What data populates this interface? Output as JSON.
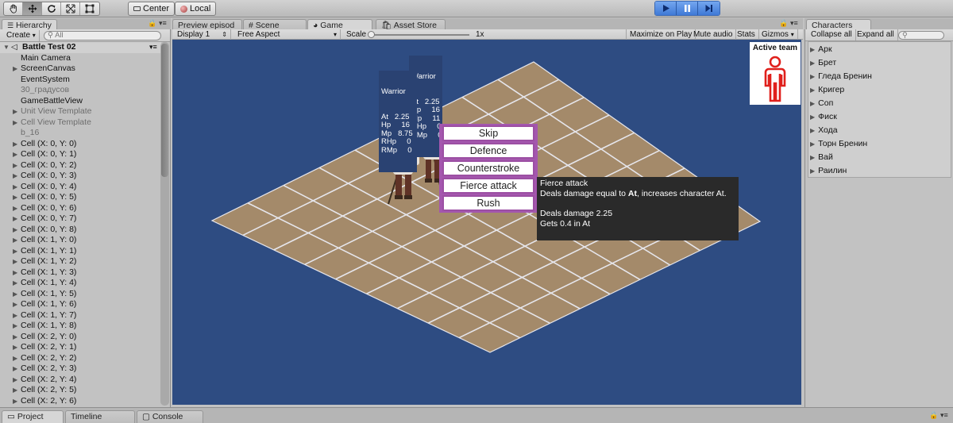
{
  "toolbar": {
    "pivot_label": "Center",
    "space_label": "Local"
  },
  "hierarchy": {
    "tab_label": "Hierarchy",
    "create_label": "Create",
    "search_placeholder": "All",
    "root_label": "Battle Test 02",
    "items": [
      {
        "label": "Main Camera",
        "expand": false,
        "inactive": false
      },
      {
        "label": "ScreenCanvas",
        "expand": true,
        "inactive": false
      },
      {
        "label": "EventSystem",
        "expand": false,
        "inactive": false
      },
      {
        "label": "30_градусов",
        "expand": false,
        "inactive": true
      },
      {
        "label": "GameBattleView",
        "expand": false,
        "inactive": false
      },
      {
        "label": "Unit View Template",
        "expand": true,
        "inactive": true
      },
      {
        "label": "Cell View Template",
        "expand": true,
        "inactive": true
      },
      {
        "label": "b_16",
        "expand": false,
        "inactive": true
      },
      {
        "label": "Cell (X: 0, Y: 0)",
        "expand": true,
        "inactive": false
      },
      {
        "label": "Cell (X: 0, Y: 1)",
        "expand": true,
        "inactive": false
      },
      {
        "label": "Cell (X: 0, Y: 2)",
        "expand": true,
        "inactive": false
      },
      {
        "label": "Cell (X: 0, Y: 3)",
        "expand": true,
        "inactive": false
      },
      {
        "label": "Cell (X: 0, Y: 4)",
        "expand": true,
        "inactive": false
      },
      {
        "label": "Cell (X: 0, Y: 5)",
        "expand": true,
        "inactive": false
      },
      {
        "label": "Cell (X: 0, Y: 6)",
        "expand": true,
        "inactive": false
      },
      {
        "label": "Cell (X: 0, Y: 7)",
        "expand": true,
        "inactive": false
      },
      {
        "label": "Cell (X: 0, Y: 8)",
        "expand": true,
        "inactive": false
      },
      {
        "label": "Cell (X: 1, Y: 0)",
        "expand": true,
        "inactive": false
      },
      {
        "label": "Cell (X: 1, Y: 1)",
        "expand": true,
        "inactive": false
      },
      {
        "label": "Cell (X: 1, Y: 2)",
        "expand": true,
        "inactive": false
      },
      {
        "label": "Cell (X: 1, Y: 3)",
        "expand": true,
        "inactive": false
      },
      {
        "label": "Cell (X: 1, Y: 4)",
        "expand": true,
        "inactive": false
      },
      {
        "label": "Cell (X: 1, Y: 5)",
        "expand": true,
        "inactive": false
      },
      {
        "label": "Cell (X: 1, Y: 6)",
        "expand": true,
        "inactive": false
      },
      {
        "label": "Cell (X: 1, Y: 7)",
        "expand": true,
        "inactive": false
      },
      {
        "label": "Cell (X: 1, Y: 8)",
        "expand": true,
        "inactive": false
      },
      {
        "label": "Cell (X: 2, Y: 0)",
        "expand": true,
        "inactive": false
      },
      {
        "label": "Cell (X: 2, Y: 1)",
        "expand": true,
        "inactive": false
      },
      {
        "label": "Cell (X: 2, Y: 2)",
        "expand": true,
        "inactive": false
      },
      {
        "label": "Cell (X: 2, Y: 3)",
        "expand": true,
        "inactive": false
      },
      {
        "label": "Cell (X: 2, Y: 4)",
        "expand": true,
        "inactive": false
      },
      {
        "label": "Cell (X: 2, Y: 5)",
        "expand": true,
        "inactive": false
      },
      {
        "label": "Cell (X: 2, Y: 6)",
        "expand": true,
        "inactive": false
      }
    ]
  },
  "center_tabs": {
    "preview_label": "Preview episod",
    "scene_label": "Scene",
    "game_label": "Game",
    "asset_store_label": "Asset Store"
  },
  "game_bar": {
    "display_label": "Display 1",
    "aspect_label": "Free Aspect",
    "scale_label": "Scale",
    "scale_value": "1x",
    "maximize_label": "Maximize on Play",
    "mute_label": "Mute audio",
    "stats_label": "Stats",
    "gizmos_label": "Gizmos"
  },
  "game": {
    "stats_back": {
      "name": "Warrior",
      "lines": "At   2.25\nHp     16\nMp     11\nRHp     0\nRMp     0"
    },
    "stats_front": {
      "name": "Warrior",
      "lines": "At   2.25\nHp     16\nMp   8.75\nRHp     0\nRMp     0"
    },
    "actions": [
      "Skip",
      "Defence",
      "Counterstroke",
      "Fierce attack",
      "Rush"
    ],
    "tooltip": {
      "title": "Fierce attack",
      "desc_prefix": "Deals damage equal to ",
      "desc_bold": "At",
      "desc_suffix": ", increases character At.",
      "damage": "Deals damage 2.25",
      "gain": "Gets 0.4 in At"
    },
    "active_team_label": "Active team",
    "active_team_color": "#e0201c"
  },
  "characters": {
    "tab_label": "Characters",
    "collapse_label": "Collapse all",
    "expand_label": "Expand all",
    "items": [
      "Арк",
      "Брет",
      "Гледа Бренин",
      "Кригер",
      "Соп",
      "Фиск",
      "Хода",
      "Торн Бренин",
      "Вай",
      "Раилин"
    ]
  },
  "bottom_tabs": {
    "project_label": "Project",
    "timeline_label": "Timeline",
    "console_label": "Console"
  }
}
